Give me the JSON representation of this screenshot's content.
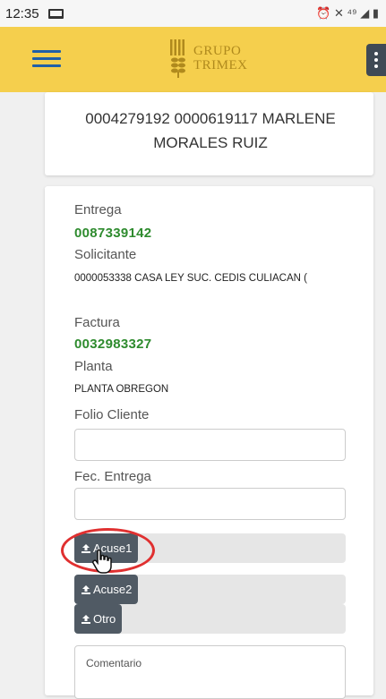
{
  "status_bar": {
    "time": "12:35",
    "right_text": "⏰ ✕ ⁴⁹ ◢ ▮"
  },
  "app_bar": {
    "logo_line1": "GRUPO",
    "logo_line2": "TRIMEX"
  },
  "client": {
    "line": "0004279192 0000619117 MARLENE MORALES RUIZ"
  },
  "detail": {
    "entrega_label": "Entrega",
    "entrega_value": "0087339142",
    "solicitante_label": "Solicitante",
    "solicitante_value": "0000053338 CASA LEY SUC. CEDIS CULIACAN (",
    "factura_label": "Factura",
    "factura_value": "0032983327",
    "planta_label": "Planta",
    "planta_value": "PLANTA OBREGON",
    "folio_label": "Folio Cliente",
    "folio_value": "",
    "fec_label": "Fec. Entrega",
    "fec_value": "",
    "uploads": [
      "Acuse1",
      "Acuse2",
      "Otro"
    ],
    "comentario_placeholder": "Comentario"
  },
  "colors": {
    "app_bar": "#f5cf4d",
    "green_value": "#2e8b2e",
    "upload_button": "#505a64",
    "highlight": "#e03030"
  }
}
